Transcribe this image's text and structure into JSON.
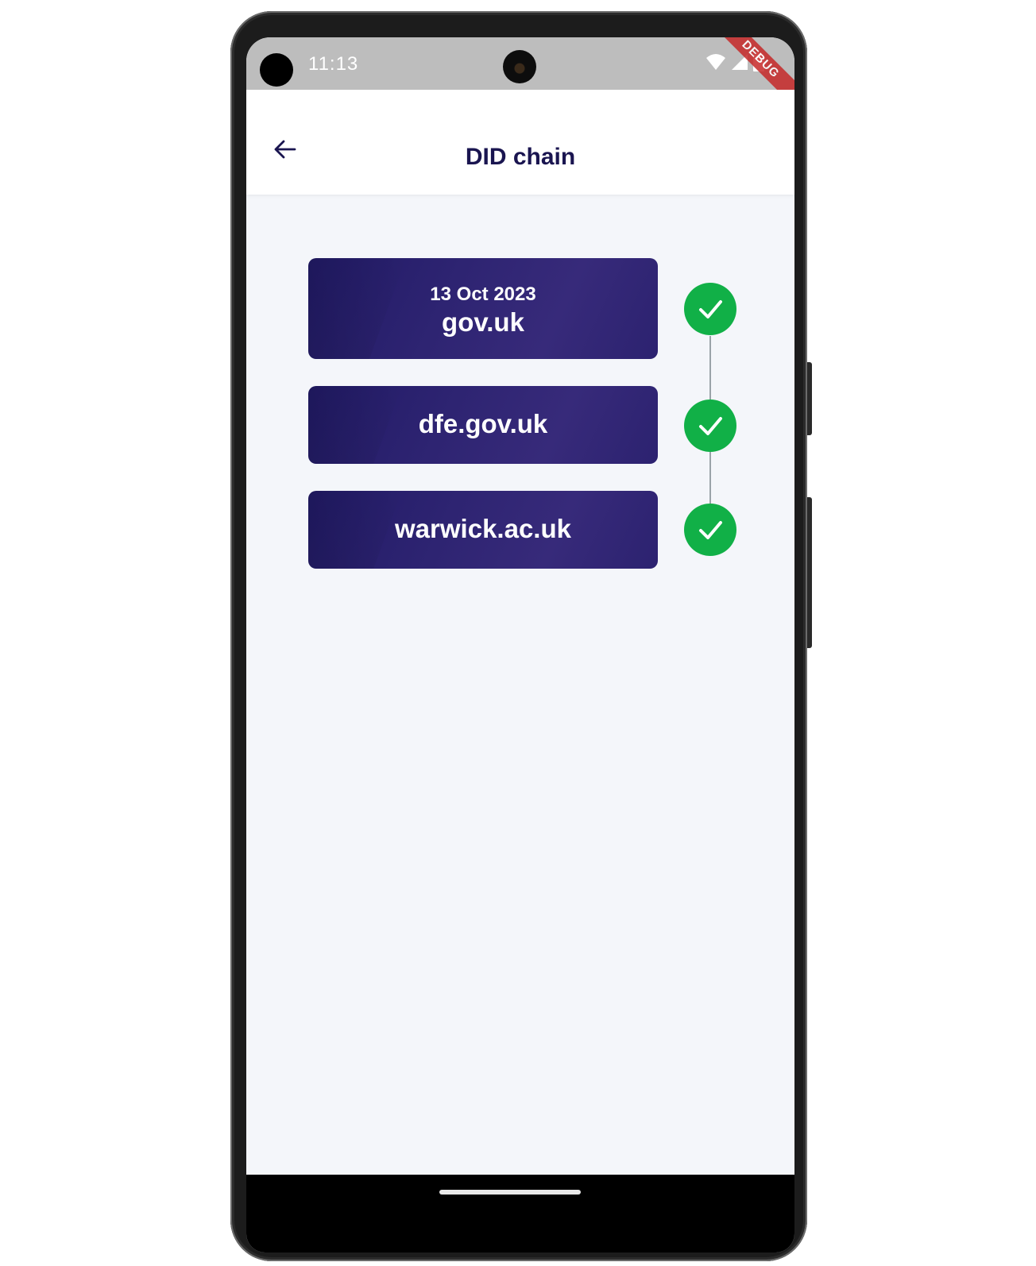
{
  "status_bar": {
    "time": "11:13",
    "debug_label": "DEBUG"
  },
  "app_bar": {
    "title": "DID chain",
    "back_icon": "arrow-left-icon"
  },
  "chain": [
    {
      "date": "13 Oct 2023",
      "domain": "gov.uk",
      "verified": true
    },
    {
      "date": "",
      "domain": "dfe.gov.uk",
      "verified": true
    },
    {
      "date": "",
      "domain": "warwick.ac.uk",
      "verified": true
    }
  ],
  "colors": {
    "card_bg": "#2e2472",
    "check_bg": "#11b047",
    "title": "#1a1550",
    "screen_bg": "#f4f6fa"
  }
}
